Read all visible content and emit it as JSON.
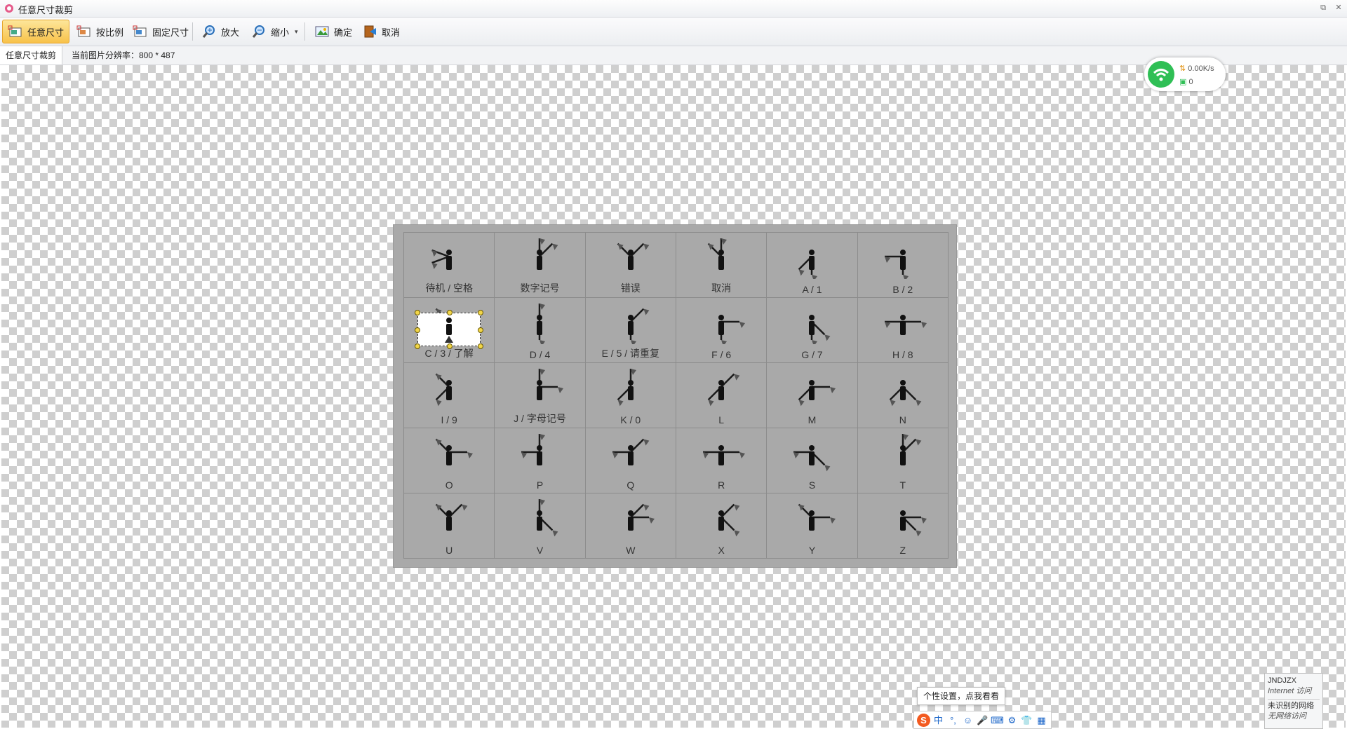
{
  "window": {
    "title": "任意尺寸裁剪",
    "controls": [
      "⧉",
      "✕"
    ]
  },
  "toolbar": {
    "buttons": [
      {
        "label": "任意尺寸",
        "icon": "crop-free-icon",
        "active": true
      },
      {
        "label": "按比例",
        "icon": "crop-ratio-icon",
        "active": false
      },
      {
        "label": "固定尺寸",
        "icon": "crop-fixed-icon",
        "active": false
      },
      {
        "label": "放大",
        "icon": "zoom-in-icon",
        "active": false
      },
      {
        "label": "缩小",
        "icon": "zoom-out-icon",
        "active": false
      },
      {
        "label": "确定",
        "icon": "confirm-icon",
        "active": false
      },
      {
        "label": "取消",
        "icon": "cancel-icon",
        "active": false
      }
    ]
  },
  "status": {
    "mode": "任意尺寸裁剪",
    "resolution": "当前图片分辨率：800 * 487"
  },
  "image": {
    "cells": [
      "待机 / 空格",
      "数字记号",
      "错误",
      "取消",
      "A / 1",
      "B / 2",
      "C / 3 / 了解",
      "D / 4",
      "E / 5 / 请重复",
      "F / 6",
      "G / 7",
      "H / 8",
      "I / 9",
      "J / 字母记号",
      "K / 0",
      "L",
      "M",
      "N",
      "O",
      "P",
      "Q",
      "R",
      "S",
      "T",
      "U",
      "V",
      "W",
      "X",
      "Y",
      "Z"
    ]
  },
  "network_widget": {
    "speed": "0.00K/s",
    "count": "0"
  },
  "ime": {
    "tooltip": "个性设置，点我看看",
    "items": [
      "S",
      "中",
      "°,",
      "☺",
      "🎤",
      "⌨",
      "⚙",
      "👕",
      "▦"
    ]
  },
  "net_toast": {
    "line1": "JNDJZX",
    "line2": "Internet 访问",
    "line3": "未识别的网络",
    "line4": "无网络访问"
  },
  "colors": {
    "active_button": "#f8c24a",
    "wifi_green": "#2fbf55",
    "handle_yellow": "#f2d649"
  }
}
